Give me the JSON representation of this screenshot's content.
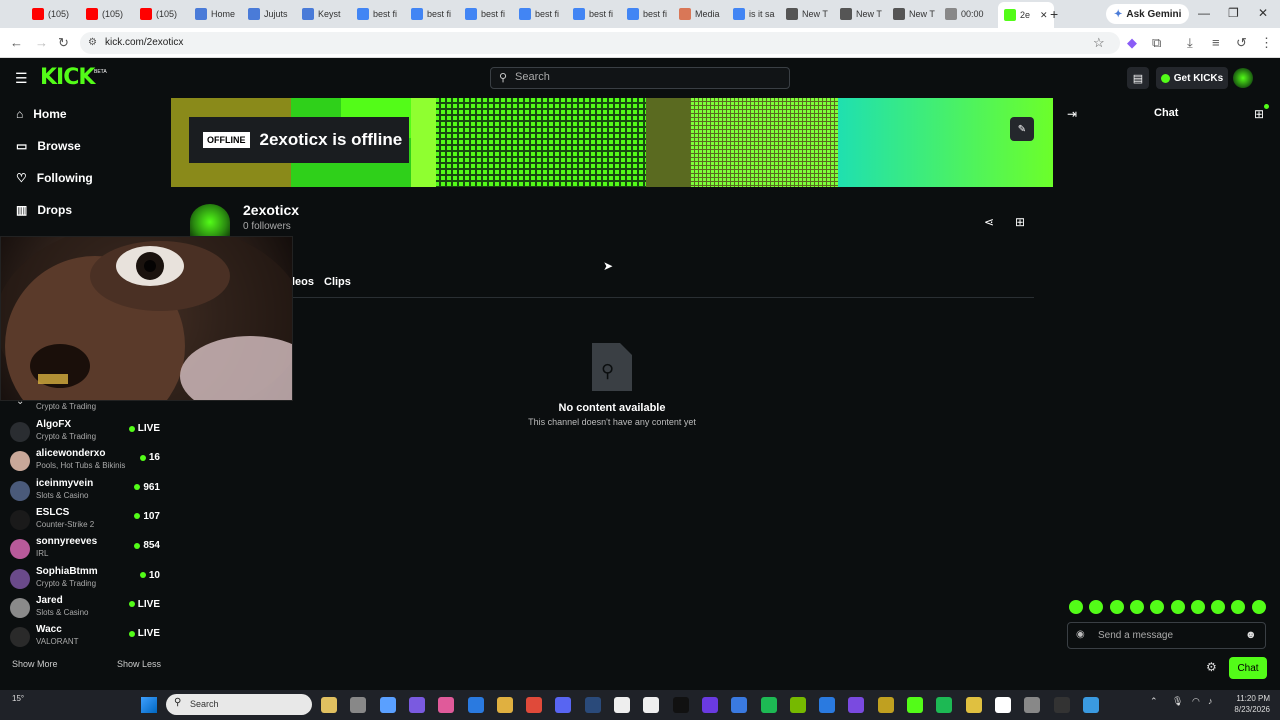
{
  "browser": {
    "tabs": [
      {
        "label": "(105)",
        "color": "#ff0000"
      },
      {
        "label": "(105)",
        "color": "#ff0000"
      },
      {
        "label": "(105)",
        "color": "#ff0000"
      },
      {
        "label": "Home",
        "color": "#4a7bd8"
      },
      {
        "label": "Jujuts",
        "color": "#4a7bd8"
      },
      {
        "label": "Keyst",
        "color": "#4a7bd8"
      },
      {
        "label": "best fi",
        "color": "#4285f4"
      },
      {
        "label": "best fi",
        "color": "#4285f4"
      },
      {
        "label": "best fi",
        "color": "#4285f4"
      },
      {
        "label": "best fi",
        "color": "#4285f4"
      },
      {
        "label": "best fi",
        "color": "#4285f4"
      },
      {
        "label": "best fi",
        "color": "#4285f4"
      },
      {
        "label": "Media",
        "color": "#d97757"
      },
      {
        "label": "is it sa",
        "color": "#4285f4"
      },
      {
        "label": "New T",
        "color": "#555555"
      },
      {
        "label": "New T",
        "color": "#555555"
      },
      {
        "label": "New T",
        "color": "#555555"
      },
      {
        "label": "00:00",
        "color": "#888888"
      },
      {
        "label": "2e",
        "color": "#53fc18"
      }
    ],
    "ask_gemini": "Ask Gemini",
    "url": "kick.com/2exoticx"
  },
  "header": {
    "logo": "KICK",
    "beta": "BETA",
    "search_placeholder": "Search",
    "get_kicks": "Get KICKs"
  },
  "sidebar": {
    "nav": [
      {
        "label": "Home",
        "icon": "home-icon"
      },
      {
        "label": "Browse",
        "icon": "browse-icon"
      },
      {
        "label": "Following",
        "icon": "heart-icon"
      },
      {
        "label": "Drops",
        "icon": "drops-icon"
      }
    ],
    "partial_category": "Crypto & Trading",
    "channels": [
      {
        "name": "AlgoFX",
        "category": "Crypto & Trading",
        "viewers": "LIVE",
        "avatar": "#2a2d31"
      },
      {
        "name": "alicewonderxo",
        "category": "Pools, Hot Tubs & Bikinis",
        "viewers": "16",
        "avatar": "#c9a899"
      },
      {
        "name": "iceinmyvein",
        "category": "Slots & Casino",
        "viewers": "961",
        "avatar": "#4a5a7a"
      },
      {
        "name": "ESLCS",
        "category": "Counter-Strike 2",
        "viewers": "107",
        "avatar": "#1a1a1a"
      },
      {
        "name": "sonnyreeves",
        "category": "IRL",
        "viewers": "854",
        "avatar": "#b85a9a"
      },
      {
        "name": "SophiaBtmm",
        "category": "Crypto & Trading",
        "viewers": "10",
        "avatar": "#6a4a8a"
      },
      {
        "name": "Jared",
        "category": "Slots & Casino",
        "viewers": "LIVE",
        "avatar": "#8a8a8a"
      },
      {
        "name": "Wacc",
        "category": "VALORANT",
        "viewers": "LIVE",
        "avatar": "#2a2a2a"
      }
    ],
    "show_more": "Show More",
    "show_less": "Show Less"
  },
  "channel": {
    "offline_tag": "OFFLINE",
    "offline_text": "2exoticx is offline",
    "name": "2exoticx",
    "followers": "0 followers",
    "tabs": [
      "Videos",
      "Clips"
    ],
    "tab_partial": "leos",
    "empty_title": "No content available",
    "empty_sub": "This channel doesn't have any content yet"
  },
  "chat": {
    "title": "Chat",
    "placeholder": "Send a message",
    "send_button": "Chat"
  },
  "taskbar": {
    "temp": "15°",
    "search": "Search",
    "time": "11:20 PM",
    "date": "8/23/2026"
  },
  "colors": {
    "accent": "#53fc18",
    "bg": "#0b0e0f"
  }
}
